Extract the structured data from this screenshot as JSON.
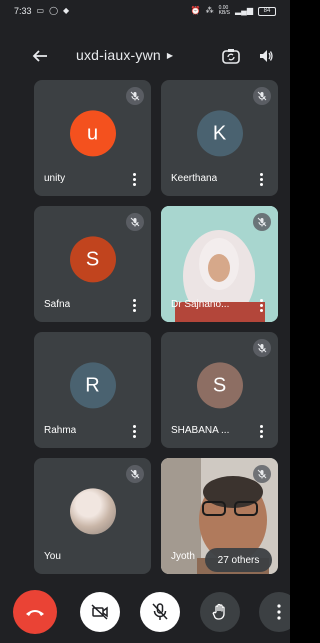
{
  "status_bar": {
    "time": "7:33",
    "left_icons": [
      "message-icon",
      "whatsapp-icon",
      "shield-icon"
    ],
    "right_icons": [
      "alarm-icon",
      "signal-icon",
      "data-speed-icon",
      "wifi-icon",
      "battery-icon"
    ],
    "data_speed": "0.00\nKB/S",
    "battery_level": "84"
  },
  "header": {
    "meeting_code": "uxd-iaux-ywn",
    "back_icon": "arrow-left-icon",
    "caret_icon": "caret-right-icon",
    "switch_camera_icon": "switch-camera-icon",
    "speaker_icon": "speaker-icon"
  },
  "participants": [
    {
      "name": "unity",
      "initial": "u",
      "avatar_color": "#f4511e",
      "muted": true,
      "video": false
    },
    {
      "name": "Keerthana",
      "initial": "K",
      "avatar_color": "#4a6270",
      "muted": true,
      "video": false
    },
    {
      "name": "Safna",
      "initial": "S",
      "avatar_color": "#c1441e",
      "muted": true,
      "video": false
    },
    {
      "name": "Dr Sajnano...",
      "initial": "",
      "avatar_color": "",
      "muted": true,
      "video": true
    },
    {
      "name": "Rahma",
      "initial": "R",
      "avatar_color": "#4a6270",
      "muted": true,
      "video": false
    },
    {
      "name": "SHABANA ...",
      "initial": "S",
      "avatar_color": "#8d6e63",
      "muted": true,
      "video": false
    },
    {
      "name": "You",
      "initial": "",
      "avatar_color": "",
      "muted": true,
      "video": false,
      "photo": true
    },
    {
      "name": "Jyoth",
      "initial": "",
      "avatar_color": "",
      "muted": true,
      "video": true
    }
  ],
  "others_pill": "27 others",
  "controls": {
    "end_call_icon": "end-call-icon",
    "camera_icon": "camera-off-icon",
    "mic_icon": "mic-off-icon",
    "hand_icon": "raise-hand-icon",
    "more_icon": "more-vertical-icon"
  },
  "colors": {
    "background": "#202124",
    "tile": "#3c4043",
    "end_call": "#ea4335"
  }
}
